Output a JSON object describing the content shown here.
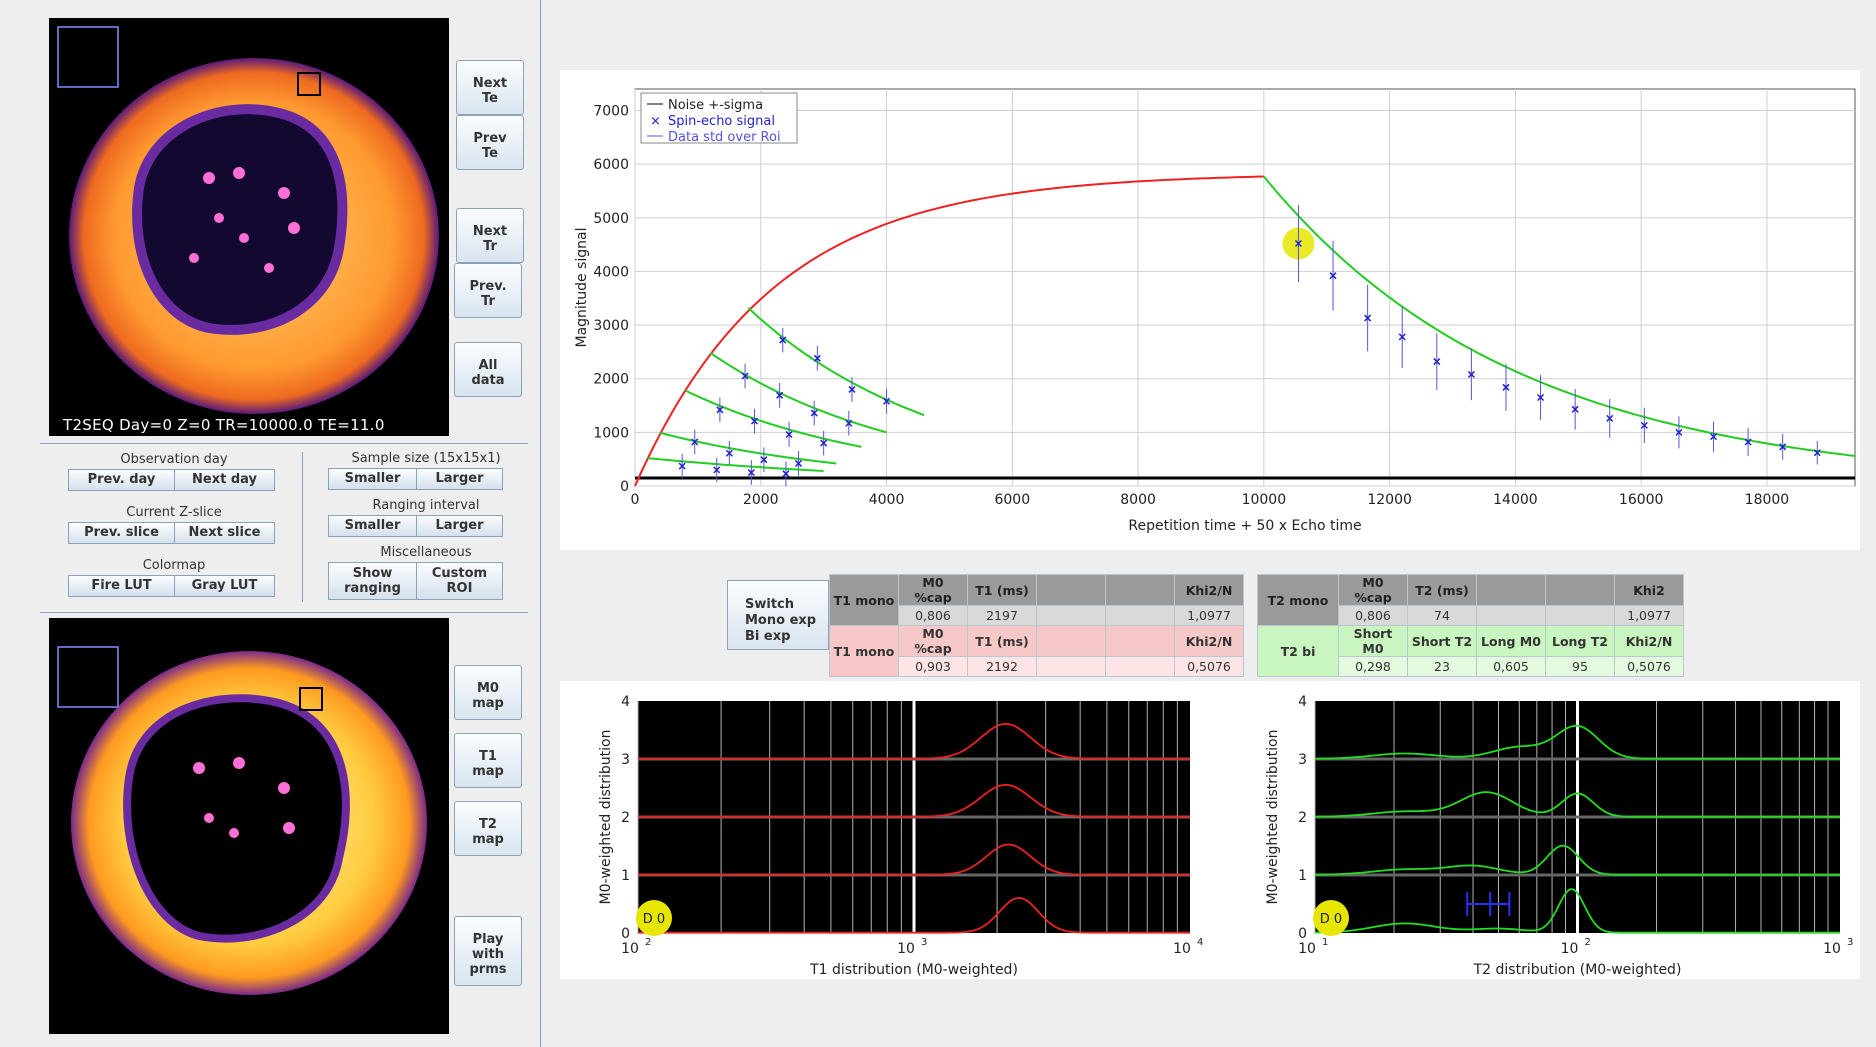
{
  "image_top": {
    "caption": "T2SEQ  Day=0   Z=0   TR=10000.0   TE=11.0"
  },
  "side_buttons_top": [
    {
      "label": "Next\nTe"
    },
    {
      "label": "Prev\nTe"
    },
    {
      "label": "Next\nTr"
    },
    {
      "label": "Prev.\nTr"
    },
    {
      "label": "All\ndata"
    }
  ],
  "side_buttons_bottom": [
    {
      "label": "M0\nmap"
    },
    {
      "label": "T1\nmap"
    },
    {
      "label": "T2\nmap"
    },
    {
      "label": "Play\nwith\nprms"
    }
  ],
  "controls": {
    "observation_day": {
      "title": "Observation day",
      "prev": "Prev. day",
      "next": "Next day"
    },
    "z_slice": {
      "title": "Current Z-slice",
      "prev": "Prev. slice",
      "next": "Next slice"
    },
    "colormap": {
      "title": "Colormap",
      "fire": "Fire LUT",
      "gray": "Gray LUT"
    },
    "sample_size": {
      "title": "Sample size (15x15x1)",
      "smaller": "Smaller",
      "larger": "Larger"
    },
    "ranging": {
      "title": "Ranging interval",
      "smaller": "Smaller",
      "larger": "Larger"
    },
    "misc": {
      "title": "Miscellaneous",
      "show_ranging": "Show\nranging",
      "custom_roi": "Custom\nROI"
    }
  },
  "switch_button": {
    "label": "Switch\nMono exp\nBi exp"
  },
  "stats_table": {
    "t1_header_row": [
      "T1 mono",
      "M0 %cap",
      "T1 (ms)",
      "",
      "",
      "Khi2/N"
    ],
    "t1_gray_values": [
      "0,806",
      "2197",
      "",
      "",
      "1,0977"
    ],
    "t1_red_row": [
      "T1 mono",
      "M0 %cap",
      "T1 (ms)",
      "",
      "",
      "Khi2/N"
    ],
    "t1_red_values": [
      "0,903",
      "2192",
      "",
      "",
      "0,5076"
    ],
    "t2_header_row": [
      "T2 mono",
      "M0 %cap",
      "T2 (ms)",
      "",
      "",
      "Khi2"
    ],
    "t2_gray_values": [
      "0,806",
      "74",
      "",
      "",
      "1,0977"
    ],
    "t2_green_row": [
      "T2 bi",
      "Short M0",
      "Short T2",
      "Long M0",
      "Long T2",
      "Khi2/N"
    ],
    "t2_green_values": [
      "0,298",
      "23",
      "0,605",
      "95",
      "0,5076"
    ]
  },
  "chart_data": [
    {
      "type": "scatter",
      "xlabel": "Repetition time + 50 x Echo time",
      "ylabel": "Magnitude signal",
      "xlim": [
        0,
        19400
      ],
      "ylim": [
        0,
        7400
      ],
      "xticks": [
        0,
        2000,
        4000,
        6000,
        8000,
        10000,
        12000,
        14000,
        16000,
        18000
      ],
      "yticks": [
        0,
        1000,
        2000,
        3000,
        4000,
        5000,
        6000,
        7000
      ],
      "grid": true,
      "legend_position": "top-left",
      "legend": [
        "Noise +-sigma",
        "Spin-echo signal",
        "Data std over Roi"
      ],
      "colors": {
        "noise": "#000000",
        "signal": "#2222cc",
        "std": "#5555dd",
        "t1_fit": "#ee2222",
        "t2_fit": "#22cc22",
        "highlight": "#e6e600"
      },
      "noise_level": 150,
      "t1_recovery": {
        "m0": 5830,
        "t1": 2197,
        "tr_max": 10000
      },
      "t2_decay": {
        "x": [
          10550,
          11100,
          11650,
          12200,
          12750,
          13300,
          13850,
          14400,
          14950,
          15500,
          16050,
          16600,
          17150,
          17700,
          18250,
          18800
        ],
        "y": [
          4520,
          3920,
          3130,
          2780,
          2320,
          2080,
          1840,
          1650,
          1430,
          1260,
          1130,
          1000,
          920,
          820,
          730,
          620
        ],
        "err": [
          720,
          650,
          620,
          580,
          530,
          480,
          440,
          420,
          380,
          360,
          330,
          300,
          280,
          260,
          240,
          220
        ],
        "fit_end": [
          19400,
          560
        ]
      },
      "tr_series": [
        {
          "tr": 1800,
          "fit_start": [
            1800,
            3320
          ],
          "fit_end": [
            4600,
            1320
          ],
          "points": [
            [
              2350,
              2720
            ],
            [
              2900,
              2380
            ],
            [
              3450,
              1800
            ],
            [
              4000,
              1580
            ]
          ]
        },
        {
          "tr": 1200,
          "fit_start": [
            1200,
            2480
          ],
          "fit_end": [
            4000,
            1000
          ],
          "points": [
            [
              1750,
              2050
            ],
            [
              2300,
              1690
            ],
            [
              2850,
              1360
            ],
            [
              3400,
              1170
            ]
          ]
        },
        {
          "tr": 800,
          "fit_start": [
            800,
            1780
          ],
          "fit_end": [
            3600,
            730
          ],
          "points": [
            [
              1350,
              1420
            ],
            [
              1900,
              1210
            ],
            [
              2450,
              960
            ],
            [
              3000,
              800
            ]
          ]
        },
        {
          "tr": 400,
          "fit_start": [
            400,
            990
          ],
          "fit_end": [
            3200,
            420
          ],
          "points": [
            [
              950,
              820
            ],
            [
              1500,
              610
            ],
            [
              2050,
              490
            ],
            [
              2600,
              420
            ]
          ]
        },
        {
          "tr": 200,
          "fit_start": [
            200,
            520
          ],
          "fit_end": [
            3000,
            280
          ],
          "points": [
            [
              750,
              370
            ],
            [
              1300,
              300
            ],
            [
              1850,
              250
            ],
            [
              2400,
              230
            ]
          ]
        }
      ],
      "highlight_point": [
        10550,
        4520
      ]
    },
    {
      "type": "line",
      "xlabel": "T1 distribution (M0-weighted)",
      "ylabel": "M0-weighted distribution",
      "xscale": "log",
      "xlim": [
        100,
        10000
      ],
      "ylim": [
        0,
        4
      ],
      "xtick_labels": [
        "10",
        "10",
        "10"
      ],
      "xtick_exponents": [
        "2",
        "3",
        "4"
      ],
      "yticks": [
        0,
        1,
        2,
        3,
        4
      ],
      "badge": "D 0",
      "series_color": "#ee2222",
      "marker_line": 1000,
      "curves": [
        {
          "offset": 3,
          "peak_x": 2150,
          "peak_h": 0.6,
          "width": 0.09
        },
        {
          "offset": 2,
          "peak_x": 2150,
          "peak_h": 0.55,
          "width": 0.09
        },
        {
          "offset": 1,
          "peak_x": 2200,
          "peak_h": 0.52,
          "width": 0.08
        },
        {
          "offset": 0,
          "peak_x": 2400,
          "peak_h": 0.6,
          "width": 0.07
        }
      ]
    },
    {
      "type": "line",
      "xlabel": "T2 distribution (M0-weighted)",
      "ylabel": "M0-weighted distribution",
      "xscale": "log",
      "xlim": [
        10,
        1000
      ],
      "ylim": [
        0,
        4
      ],
      "xtick_labels": [
        "10",
        "10",
        "10"
      ],
      "xtick_exponents": [
        "1",
        "2",
        "3"
      ],
      "yticks": [
        0,
        1,
        2,
        3,
        4
      ],
      "badge": "D 0",
      "series_color": "#22dd22",
      "marker_line": 100,
      "range_marker": [
        38,
        55
      ],
      "curves": [
        {
          "offset": 3,
          "peaks": [
            [
              22,
              0.09,
              0.12
            ],
            [
              60,
              0.2,
              0.1
            ],
            [
              100,
              0.55,
              0.08
            ]
          ]
        },
        {
          "offset": 2,
          "peaks": [
            [
              22,
              0.09,
              0.12
            ],
            [
              45,
              0.42,
              0.1
            ],
            [
              100,
              0.4,
              0.06
            ]
          ]
        },
        {
          "offset": 1,
          "peaks": [
            [
              22,
              0.09,
              0.12
            ],
            [
              40,
              0.15,
              0.1
            ],
            [
              88,
              0.5,
              0.06
            ]
          ]
        },
        {
          "offset": 0,
          "peaks": [
            [
              22,
              0.16,
              0.12
            ],
            [
              50,
              0.07,
              0.1
            ],
            [
              95,
              0.75,
              0.05
            ]
          ]
        }
      ]
    }
  ]
}
